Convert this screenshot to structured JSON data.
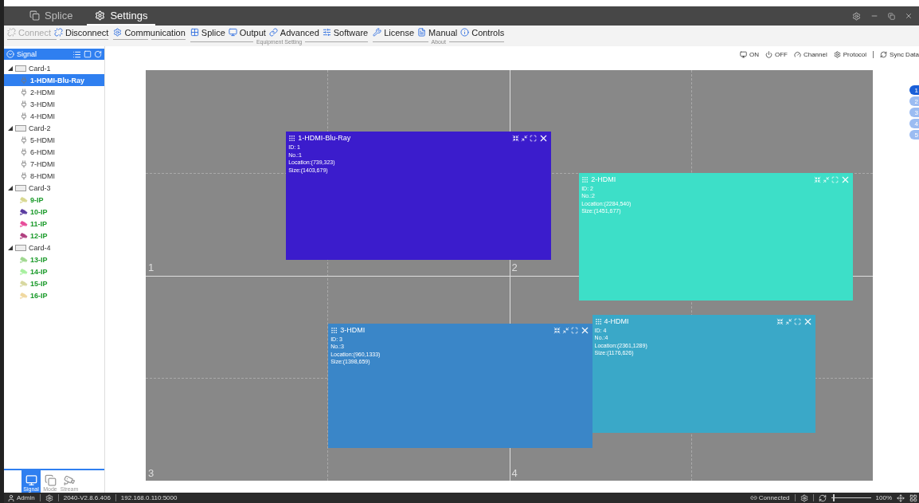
{
  "title_bar": {
    "tabs": [
      {
        "label": "Splice",
        "selected": false
      },
      {
        "label": "Settings",
        "selected": true
      }
    ]
  },
  "toolbar": {
    "groups": [
      {
        "items": [
          {
            "label": "Connect",
            "disabled": true
          },
          {
            "label": "Disconnect",
            "disabled": false
          }
        ]
      },
      {
        "items": [
          {
            "label": "Communication",
            "disabled": false
          }
        ]
      },
      {
        "label": "Equipment Setting",
        "items": [
          {
            "label": "Splice",
            "disabled": false
          },
          {
            "label": "Output",
            "disabled": false
          },
          {
            "label": "Advanced",
            "disabled": false
          },
          {
            "label": "Software",
            "disabled": false
          }
        ]
      },
      {
        "label": "About",
        "items": [
          {
            "label": "License",
            "disabled": false
          },
          {
            "label": "Manual",
            "disabled": false
          },
          {
            "label": "Controls",
            "disabled": false
          }
        ]
      }
    ]
  },
  "signal_panel": {
    "title": "Signal",
    "tree": [
      {
        "label": "Card-1",
        "expanded": true,
        "children": [
          {
            "label": "1-HDMI-Blu-Ray",
            "kind": "hdmi",
            "selected": true
          },
          {
            "label": "2-HDMI",
            "kind": "hdmi",
            "selected": false
          },
          {
            "label": "3-HDMI",
            "kind": "hdmi",
            "selected": false
          },
          {
            "label": "4-HDMI",
            "kind": "hdmi",
            "selected": false
          }
        ]
      },
      {
        "label": "Card-2",
        "expanded": true,
        "children": [
          {
            "label": "5-HDMI",
            "kind": "hdmi",
            "selected": false
          },
          {
            "label": "6-HDMI",
            "kind": "hdmi",
            "selected": false
          },
          {
            "label": "7-HDMI",
            "kind": "hdmi",
            "selected": false
          },
          {
            "label": "8-HDMI",
            "kind": "hdmi",
            "selected": false
          }
        ]
      },
      {
        "label": "Card-3",
        "expanded": true,
        "children": [
          {
            "label": "9-IP",
            "kind": "ip",
            "selected": false,
            "color": "#d8d890"
          },
          {
            "label": "10-IP",
            "kind": "ip",
            "selected": false,
            "color": "#5a3ca0"
          },
          {
            "label": "11-IP",
            "kind": "ip",
            "selected": false,
            "color": "#e84c9a"
          },
          {
            "label": "12-IP",
            "kind": "ip",
            "selected": false,
            "color": "#b04080"
          }
        ]
      },
      {
        "label": "Card-4",
        "expanded": true,
        "children": [
          {
            "label": "13-IP",
            "kind": "ip",
            "selected": false,
            "color": "#a0d890"
          },
          {
            "label": "14-IP",
            "kind": "ip",
            "selected": false,
            "color": "#a8f0a0"
          },
          {
            "label": "15-IP",
            "kind": "ip",
            "selected": false,
            "color": "#d8d8a0"
          },
          {
            "label": "16-IP",
            "kind": "ip",
            "selected": false,
            "color": "#f0d8a0"
          }
        ]
      }
    ],
    "bottom_tabs": [
      {
        "label": "Signal",
        "selected": true
      },
      {
        "label": "Mode",
        "selected": false
      },
      {
        "label": "Stream",
        "selected": false
      }
    ]
  },
  "canvas_toolbar": [
    "ON",
    "OFF",
    "Channel",
    "Protocol",
    "Sync Data"
  ],
  "canvas": {
    "screens": [
      "1",
      "2",
      "3",
      "4"
    ],
    "windows": [
      {
        "title": "1-HDMI-Blu-Ray",
        "id": "ID:  1",
        "no": "No.:1",
        "location": "Location:(739,323)",
        "size": "Size:(1403,679)",
        "color": "#3b1ccc"
      },
      {
        "title": "2-HDMI",
        "id": "ID:  2",
        "no": "No.:2",
        "location": "Location:(2284,540)",
        "size": "Size:(1451,677)",
        "color": "#3ddfc8"
      },
      {
        "title": "3-HDMI",
        "id": "ID:  3",
        "no": "No.:3",
        "location": "Location:(960,1333)",
        "size": "Size:(1398,659)",
        "color": "#3a86c8"
      },
      {
        "title": "4-HDMI",
        "id": "ID:  4",
        "no": "No.:4",
        "location": "Location:(2361,1289)",
        "size": "Size:(1176,626)",
        "color": "#3aa8c8"
      }
    ]
  },
  "pages": [
    {
      "label": "1",
      "selected": true
    },
    {
      "label": "2",
      "selected": false
    },
    {
      "label": "3",
      "selected": false
    },
    {
      "label": "4",
      "selected": false
    },
    {
      "label": "5",
      "selected": false
    }
  ],
  "status_bar": {
    "user": "Admin",
    "version": "2040-V2.8.6.406",
    "address": "192.168.0.110:5000",
    "connection": "Connected",
    "zoom": {
      "level": 0.05
    },
    "zoom_reading": "100%"
  }
}
